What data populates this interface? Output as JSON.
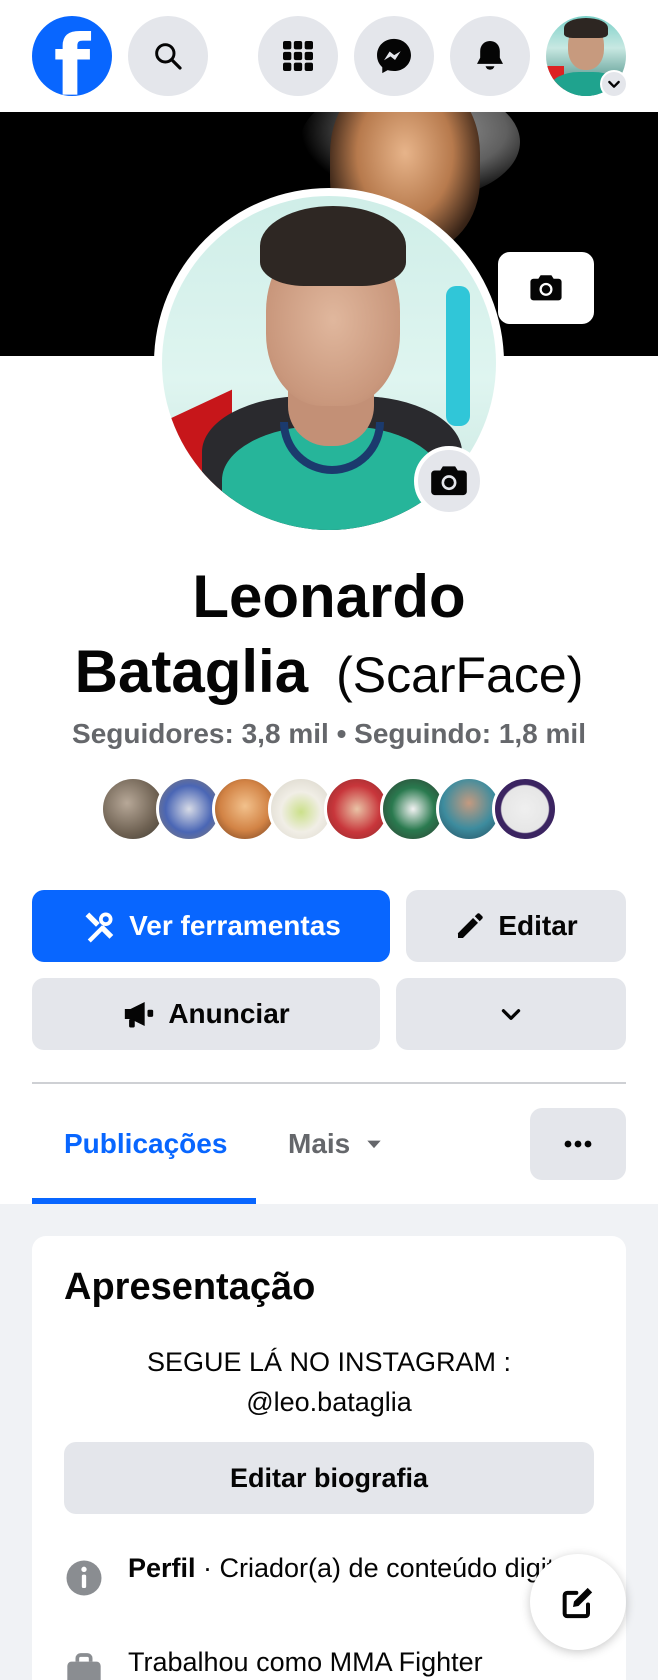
{
  "profile": {
    "first_name": "Leonardo",
    "last_name": "Bataglia",
    "alternate_name": "(ScarFace)",
    "followers_label": "Seguidores:",
    "followers_value": "3,8 mil",
    "separator": "•",
    "following_label": "Seguindo:",
    "following_value": "1,8 mil"
  },
  "actions": {
    "tools": "Ver ferramentas",
    "edit": "Editar",
    "advertise": "Anunciar"
  },
  "tabs": {
    "posts": "Publicações",
    "more": "Mais"
  },
  "intro": {
    "title": "Apresentação",
    "bio_line1": "SEGUE LÁ NO INSTAGRAM :",
    "bio_line2": "@leo.bataglia",
    "edit_bio": "Editar biografia",
    "profile_label": "Perfil",
    "profile_value": " · Criador(a) de conteúdo digital",
    "work": "Trabalhou como MMA Fighter"
  },
  "colors": {
    "brand": "#0866ff",
    "button_gray": "#e4e6eb",
    "muted_text": "#65676b",
    "background": "#f0f2f5"
  }
}
